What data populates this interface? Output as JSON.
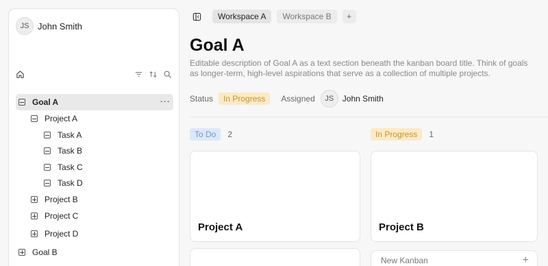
{
  "sidebar": {
    "user": {
      "initials": "JS",
      "name": "John Smith"
    },
    "icons": [
      "home-icon",
      "filter-icon",
      "sort-icon",
      "search-icon"
    ],
    "tree": [
      {
        "label": "Goal A",
        "expanded": true,
        "selected": true,
        "more": "···"
      },
      {
        "label": "Project A",
        "expanded": true
      },
      {
        "label": "Task A",
        "expanded": true
      },
      {
        "label": "Task B",
        "expanded": true
      },
      {
        "label": "Task C",
        "expanded": true
      },
      {
        "label": "Task D",
        "expanded": true
      },
      {
        "label": "Project B",
        "expanded": false
      },
      {
        "label": "Project C",
        "expanded": false
      },
      {
        "label": "Project D",
        "expanded": false
      },
      {
        "label": "Goal B",
        "expanded": false
      }
    ]
  },
  "topbar": {
    "tabs": [
      {
        "label": "Workspace A",
        "active": true
      },
      {
        "label": "Workspace B",
        "active": false
      }
    ],
    "add_label": "+"
  },
  "goal": {
    "title": "Goal A",
    "description": "Editable description of Goal A as a text section beneath the kanban board title. Think of goals as longer-term, high-level aspirations that serve as a collection of multiple projects.",
    "status_label": "Status",
    "status_value": "In Progress",
    "assigned_label": "Assigned",
    "assignee_initials": "JS",
    "assignee_name": "John Smith"
  },
  "board": {
    "columns": [
      {
        "label": "To Do",
        "count": "2",
        "cards": [
          "Project A",
          ""
        ]
      },
      {
        "label": "In Progress",
        "count": "1",
        "cards": [
          "Project B"
        ]
      }
    ],
    "new_kanban_label": "New Kanban",
    "new_kanban_plus": "+"
  },
  "colors": {
    "todo_bg": "#dde8f7",
    "todo_text": "#6f97cf",
    "progress_bg": "#fbeac8",
    "progress_text": "#c8952b"
  }
}
